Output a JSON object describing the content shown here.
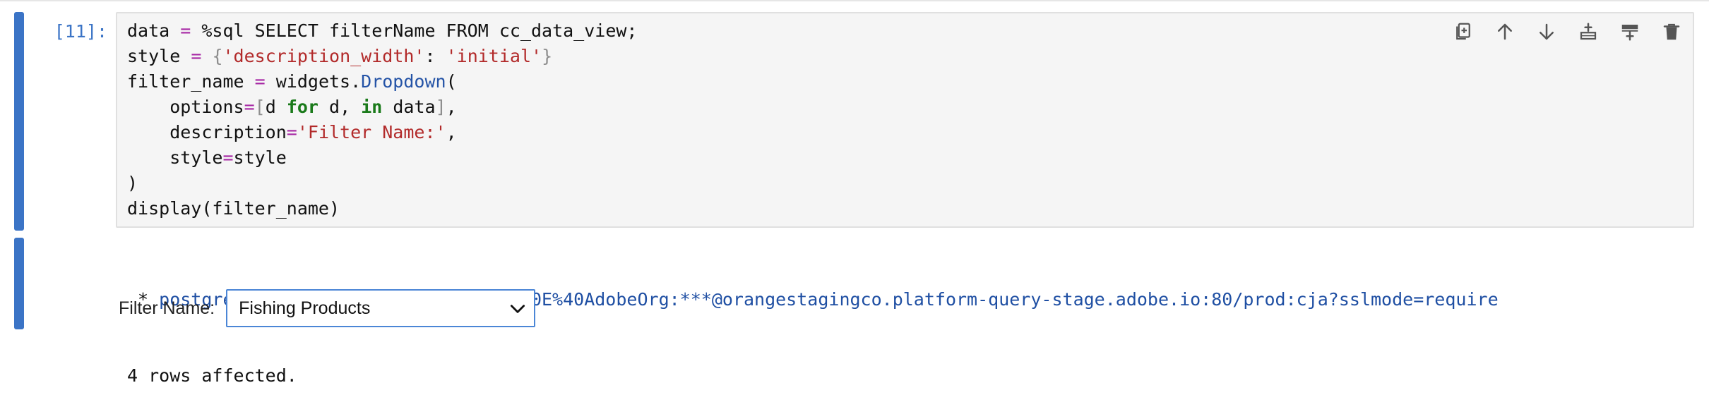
{
  "cell": {
    "prompt": "[11]:",
    "code_lines": [
      {
        "parts": [
          {
            "t": "data ",
            "c": "#111111"
          },
          {
            "t": "=",
            "c": "#a626a4"
          },
          {
            "t": " %sql SELECT filterName FROM cc_data_view;",
            "c": "#111111"
          }
        ]
      },
      {
        "parts": [
          {
            "t": "style ",
            "c": "#111111"
          },
          {
            "t": "=",
            "c": "#a626a4"
          },
          {
            "t": " ",
            "c": "#111111"
          },
          {
            "t": "{",
            "c": "#8e8e8e"
          },
          {
            "t": "'description_width'",
            "c": "#b22a2a"
          },
          {
            "t": ": ",
            "c": "#111111"
          },
          {
            "t": "'initial'",
            "c": "#b22a2a"
          },
          {
            "t": "}",
            "c": "#8e8e8e"
          }
        ]
      },
      {
        "parts": [
          {
            "t": "filter_name ",
            "c": "#111111"
          },
          {
            "t": "=",
            "c": "#a626a4"
          },
          {
            "t": " widgets.",
            "c": "#111111"
          },
          {
            "t": "Dropdown",
            "c": "#2453a6"
          },
          {
            "t": "(",
            "c": "#111111"
          }
        ]
      },
      {
        "parts": [
          {
            "t": "    options",
            "c": "#111111"
          },
          {
            "t": "=",
            "c": "#a626a4"
          },
          {
            "t": "[",
            "c": "#8e8e8e"
          },
          {
            "t": "d ",
            "c": "#111111"
          },
          {
            "t": "for",
            "c": "#1a7a1a",
            "b": true
          },
          {
            "t": " d, ",
            "c": "#111111"
          },
          {
            "t": "in",
            "c": "#1a7a1a",
            "b": true
          },
          {
            "t": " data",
            "c": "#111111"
          },
          {
            "t": "]",
            "c": "#8e8e8e"
          },
          {
            "t": ",",
            "c": "#111111"
          }
        ]
      },
      {
        "parts": [
          {
            "t": "    description",
            "c": "#111111"
          },
          {
            "t": "=",
            "c": "#a626a4"
          },
          {
            "t": "'Filter Name:'",
            "c": "#b22a2a"
          },
          {
            "t": ",",
            "c": "#111111"
          }
        ]
      },
      {
        "parts": [
          {
            "t": "    style",
            "c": "#111111"
          },
          {
            "t": "=",
            "c": "#a626a4"
          },
          {
            "t": "style",
            "c": "#111111"
          }
        ]
      },
      {
        "parts": [
          {
            "t": ")",
            "c": "#111111"
          }
        ]
      },
      {
        "parts": [
          {
            "t": "display(filter_name)",
            "c": "#111111"
          }
        ]
      }
    ],
    "toolbar": [
      {
        "name": "duplicate-icon"
      },
      {
        "name": "arrow-up-icon"
      },
      {
        "name": "arrow-down-icon"
      },
      {
        "name": "insert-above-icon"
      },
      {
        "name": "insert-below-icon"
      },
      {
        "name": "trash-icon"
      }
    ]
  },
  "output": {
    "connection_prefix": " * ",
    "connection": "postgresql://EC582F955C8A79F70A49420E%40AdobeOrg:***@orangestagingco.platform-query-stage.adobe.io:80/prod:cja?sslmode=require",
    "rows_text": "4 rows affected."
  },
  "widget": {
    "label": "Filter Name:",
    "selected": "Fishing Products"
  },
  "colors": {
    "accent": "#3b74c6",
    "operator": "#a626a4",
    "string": "#b22a2a",
    "keyword": "#1a7a1a",
    "builtin": "#2453a6"
  }
}
